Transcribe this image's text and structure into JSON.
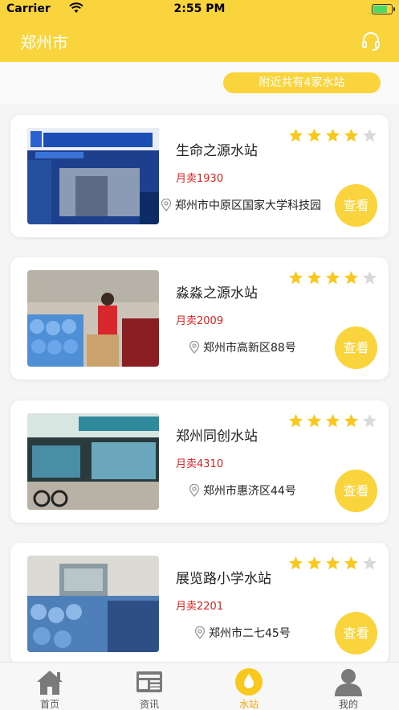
{
  "status_bar": {
    "carrier": "Carrier",
    "time": "2:55 PM"
  },
  "header": {
    "title": "郑州市",
    "support_icon": "headset-icon"
  },
  "summary": {
    "text": "附近共有4家水站"
  },
  "stations": [
    {
      "name": "生命之源水站",
      "sales": "月卖1930",
      "address": "郑州市中原区国家大学科技园",
      "rating": 4,
      "max_rating": 5,
      "view_label": "查看"
    },
    {
      "name": "淼淼之源水站",
      "sales": "月卖2009",
      "address": "郑州市高新区88号",
      "rating": 4,
      "max_rating": 5,
      "view_label": "查看"
    },
    {
      "name": "郑州同创水站",
      "sales": "月卖4310",
      "address": "郑州市惠济区44号",
      "rating": 4,
      "max_rating": 5,
      "view_label": "查看"
    },
    {
      "name": "展览路小学水站",
      "sales": "月卖2201",
      "address": "郑州市二七45号",
      "rating": 4,
      "max_rating": 5,
      "view_label": "查看"
    }
  ],
  "tabs": [
    {
      "label": "首页",
      "icon": "home-icon"
    },
    {
      "label": "资讯",
      "icon": "news-icon"
    },
    {
      "label": "水站",
      "icon": "water-drop-icon",
      "active": true
    },
    {
      "label": "我的",
      "icon": "user-icon"
    }
  ],
  "colors": {
    "accent": "#f9d43c",
    "sales": "#e02020",
    "star_on": "#f9c81e",
    "star_off": "#d9d9d9"
  }
}
